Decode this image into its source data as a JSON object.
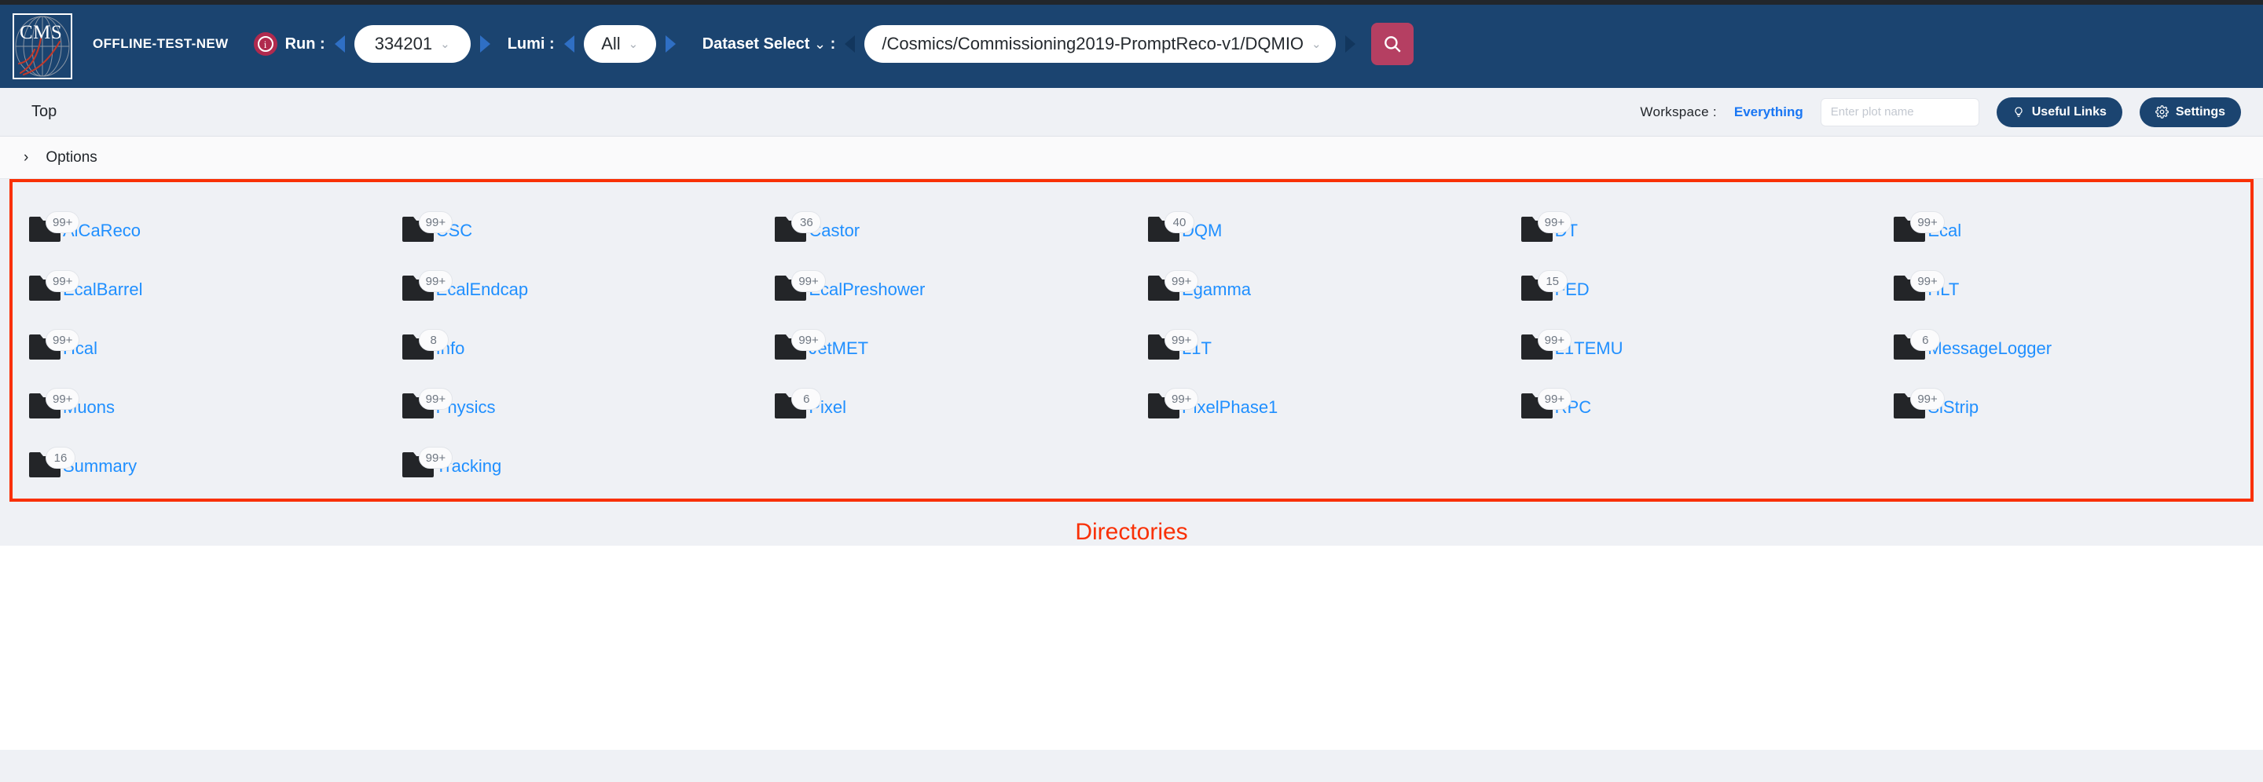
{
  "topbar": {
    "logo_text": "CMS",
    "logo_name": "cms-logo",
    "brand": "OFFLINE-TEST-NEW",
    "info_icon": "info-icon",
    "run_label": "Run :",
    "run_value": "334201",
    "lumi_label": "Lumi :",
    "lumi_value": "All",
    "dataset_label": "Dataset Select",
    "dataset_label_caret": "⌄",
    "dataset_label_colon": ":",
    "dataset_value": "/Cosmics/Commissioning2019-PromptReco-v1/DQMIO",
    "chevron": "⌄",
    "search_icon": "search-icon",
    "bg_color": "#1b4470",
    "search_btn_color": "#b53f62"
  },
  "subbar": {
    "breadcrumb": "Top",
    "workspace_label": "Workspace :",
    "workspace_value": "Everything",
    "plot_search_placeholder": "Enter plot name",
    "plot_search_value": "",
    "search_icon": "search-icon",
    "useful_links_label": "Useful Links",
    "useful_links_icon": "lightbulb-icon",
    "settings_label": "Settings",
    "settings_icon": "gear-icon",
    "accent_color": "#1976f3"
  },
  "options": {
    "chevron": "›",
    "label": "Options"
  },
  "directories": {
    "annotation": "Directories",
    "annotation_color": "#f93005",
    "highlight_color": "#f93005",
    "link_color": "#1f8fff",
    "items": [
      {
        "name": "AlCaReco",
        "count": "99+"
      },
      {
        "name": "CSC",
        "count": "99+"
      },
      {
        "name": "Castor",
        "count": "36"
      },
      {
        "name": "DQM",
        "count": "40"
      },
      {
        "name": "DT",
        "count": "99+"
      },
      {
        "name": "Ecal",
        "count": "99+"
      },
      {
        "name": "EcalBarrel",
        "count": "99+"
      },
      {
        "name": "EcalEndcap",
        "count": "99+"
      },
      {
        "name": "EcalPreshower",
        "count": "99+"
      },
      {
        "name": "Egamma",
        "count": "99+"
      },
      {
        "name": "FED",
        "count": "15"
      },
      {
        "name": "HLT",
        "count": "99+"
      },
      {
        "name": "Hcal",
        "count": "99+"
      },
      {
        "name": "Info",
        "count": "8"
      },
      {
        "name": "JetMET",
        "count": "99+"
      },
      {
        "name": "L1T",
        "count": "99+"
      },
      {
        "name": "L1TEMU",
        "count": "99+"
      },
      {
        "name": "MessageLogger",
        "count": "6"
      },
      {
        "name": "Muons",
        "count": "99+"
      },
      {
        "name": "Physics",
        "count": "99+"
      },
      {
        "name": "Pixel",
        "count": "6"
      },
      {
        "name": "PixelPhase1",
        "count": "99+"
      },
      {
        "name": "RPC",
        "count": "99+"
      },
      {
        "name": "SiStrip",
        "count": "99+"
      },
      {
        "name": "Summary",
        "count": "16"
      },
      {
        "name": "Tracking",
        "count": "99+"
      }
    ]
  }
}
